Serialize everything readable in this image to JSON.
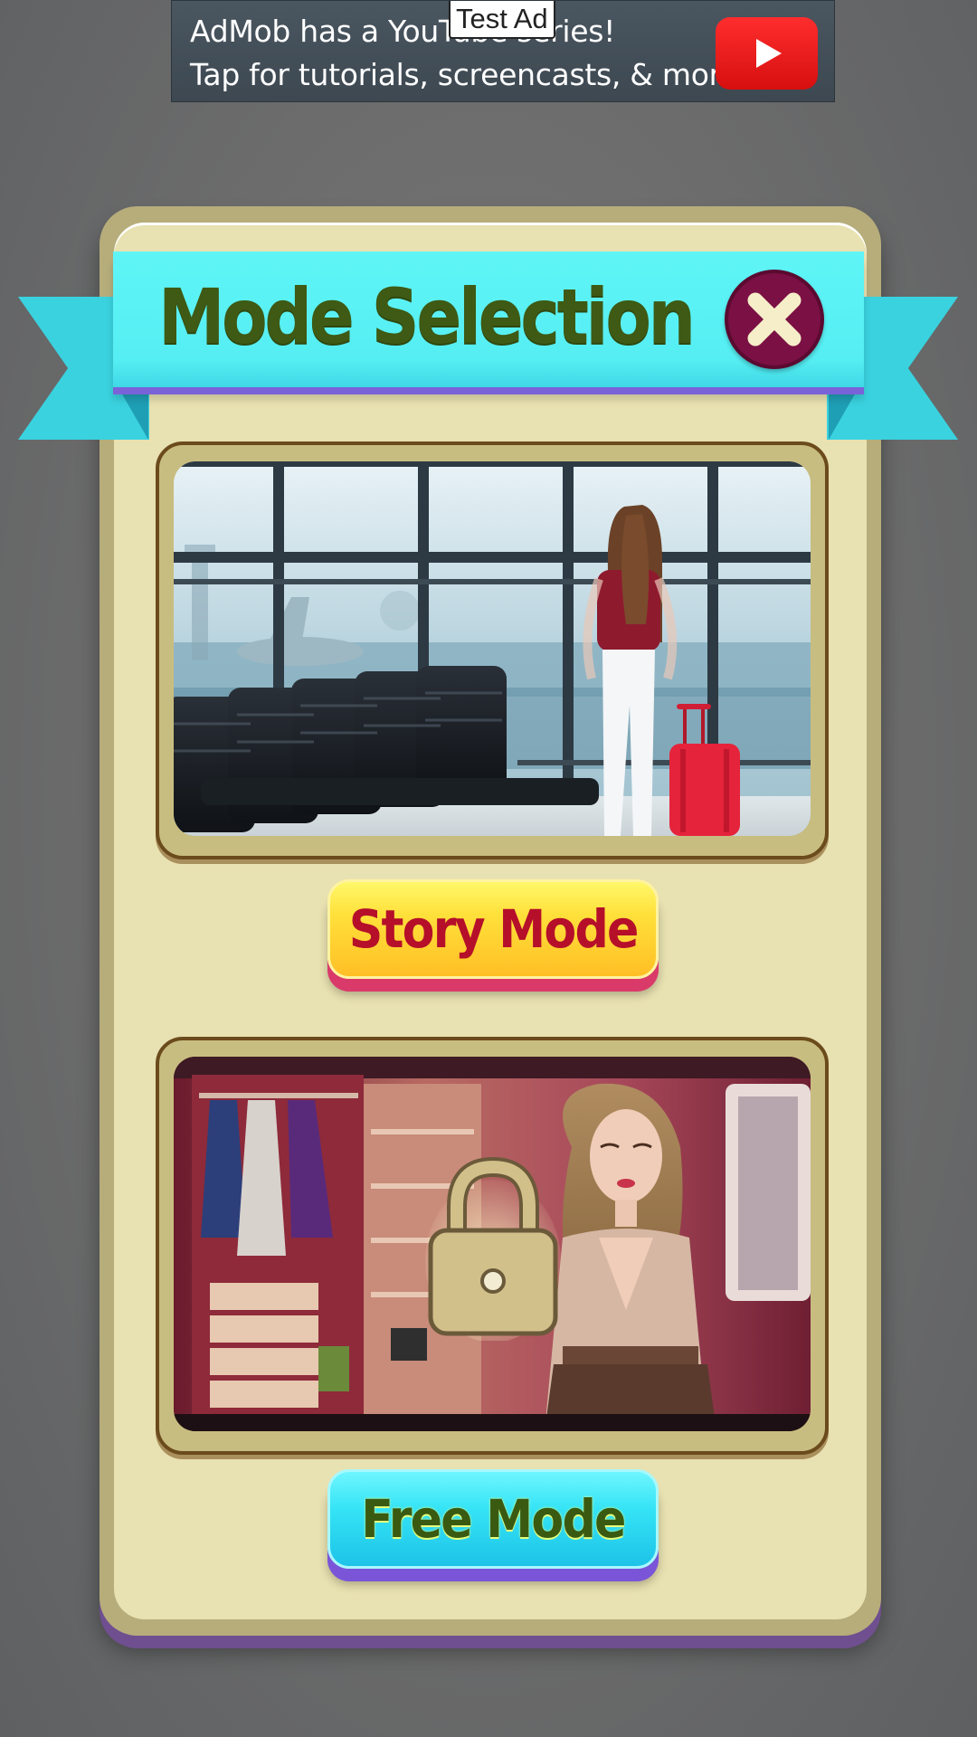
{
  "ad": {
    "line1": "AdMob has a YouTube series!",
    "line2": "Tap for tutorials, screencasts, & more.",
    "tag": "Test Ad",
    "icon": "youtube-play-icon"
  },
  "dialog": {
    "title": "Mode Selection",
    "close_icon": "close-icon",
    "modes": [
      {
        "label": "Story Mode",
        "image": "airport-departure-scene",
        "locked": false
      },
      {
        "label": "Free Mode",
        "image": "dressing-room-scene",
        "locked": true,
        "lock_icon": "padlock-icon"
      }
    ]
  },
  "colors": {
    "backdrop": "#6c6c6c",
    "panel": "#e8e1b1",
    "ribbon": "#55eef2",
    "title_text": "#3e5a14",
    "close_button": "#7a1044",
    "story_button": "#ffd23a",
    "story_text": "#b50f2a",
    "free_button": "#34e3f5",
    "free_text": "#3a5a12"
  }
}
